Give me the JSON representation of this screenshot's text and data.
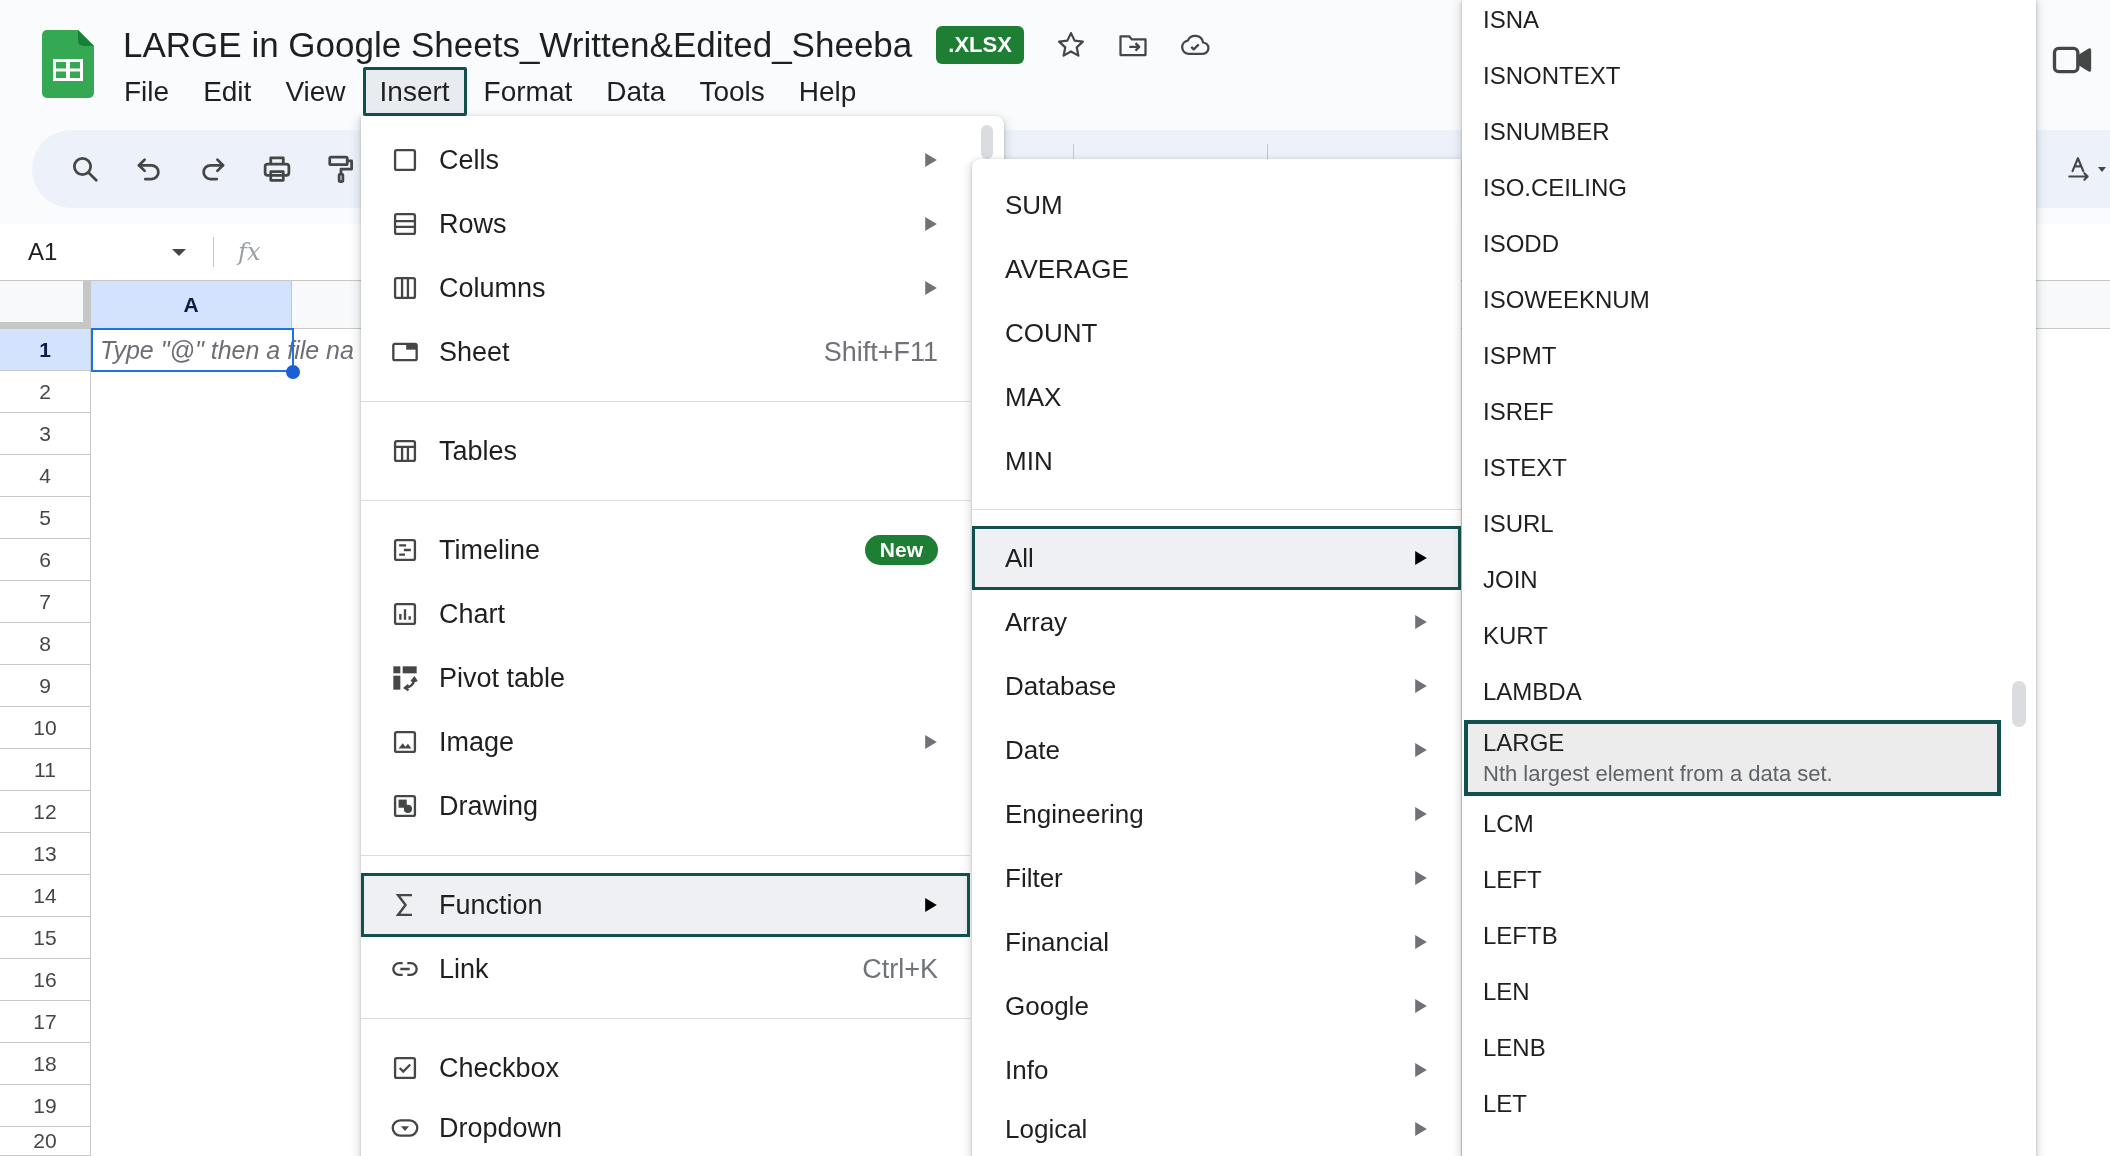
{
  "document": {
    "title": "LARGE in Google Sheets_Written&Edited_Sheeba",
    "file_type_badge": ".XLSX"
  },
  "menu_bar": [
    {
      "label": "File",
      "selected": false
    },
    {
      "label": "Edit",
      "selected": false
    },
    {
      "label": "View",
      "selected": false
    },
    {
      "label": "Insert",
      "selected": true
    },
    {
      "label": "Format",
      "selected": false
    },
    {
      "label": "Data",
      "selected": false
    },
    {
      "label": "Tools",
      "selected": false
    },
    {
      "label": "Help",
      "selected": false
    }
  ],
  "formula_bar": {
    "cell_reference": "A1",
    "function_symbol": "fx"
  },
  "grid": {
    "columns": [
      {
        "label": "A",
        "selected": true
      }
    ],
    "rows": [
      {
        "label": "1",
        "selected": true
      },
      {
        "label": "2",
        "selected": false
      },
      {
        "label": "3",
        "selected": false
      },
      {
        "label": "4",
        "selected": false
      },
      {
        "label": "5",
        "selected": false
      },
      {
        "label": "6",
        "selected": false
      },
      {
        "label": "7",
        "selected": false
      },
      {
        "label": "8",
        "selected": false
      },
      {
        "label": "9",
        "selected": false
      },
      {
        "label": "10",
        "selected": false
      },
      {
        "label": "11",
        "selected": false
      },
      {
        "label": "12",
        "selected": false
      },
      {
        "label": "13",
        "selected": false
      },
      {
        "label": "14",
        "selected": false
      },
      {
        "label": "15",
        "selected": false
      },
      {
        "label": "16",
        "selected": false
      },
      {
        "label": "17",
        "selected": false
      },
      {
        "label": "18",
        "selected": false
      },
      {
        "label": "19",
        "selected": false
      },
      {
        "label": "20",
        "selected": false
      }
    ],
    "active_cell": {
      "placeholder": "Type \"@\" then a file na"
    }
  },
  "insert_menu": {
    "sections": [
      {
        "items": [
          {
            "label": "Cells",
            "has_submenu": true,
            "selected": false
          },
          {
            "label": "Rows",
            "has_submenu": true,
            "selected": false
          },
          {
            "label": "Columns",
            "has_submenu": true,
            "selected": false
          },
          {
            "label": "Sheet",
            "shortcut": "Shift+F11",
            "has_submenu": false,
            "selected": false
          }
        ]
      },
      {
        "items": [
          {
            "label": "Tables",
            "has_submenu": false,
            "selected": false
          }
        ]
      },
      {
        "items": [
          {
            "label": "Timeline",
            "badge": "New",
            "has_submenu": false,
            "selected": false
          },
          {
            "label": "Chart",
            "has_submenu": false,
            "selected": false
          },
          {
            "label": "Pivot table",
            "has_submenu": false,
            "selected": false
          },
          {
            "label": "Image",
            "has_submenu": true,
            "selected": false
          },
          {
            "label": "Drawing",
            "has_submenu": false,
            "selected": false
          }
        ]
      },
      {
        "items": [
          {
            "label": "Function",
            "has_submenu": true,
            "selected": true
          },
          {
            "label": "Link",
            "shortcut": "Ctrl+K",
            "has_submenu": false,
            "selected": false
          }
        ]
      },
      {
        "items": [
          {
            "label": "Checkbox",
            "has_submenu": false,
            "selected": false
          },
          {
            "label": "Dropdown",
            "has_submenu": false,
            "selected": false
          }
        ]
      }
    ]
  },
  "function_menu": {
    "sections": [
      {
        "items": [
          {
            "label": "SUM",
            "has_submenu": false,
            "selected": false
          },
          {
            "label": "AVERAGE",
            "has_submenu": false,
            "selected": false
          },
          {
            "label": "COUNT",
            "has_submenu": false,
            "selected": false
          },
          {
            "label": "MAX",
            "has_submenu": false,
            "selected": false
          },
          {
            "label": "MIN",
            "has_submenu": false,
            "selected": false
          }
        ]
      },
      {
        "items": [
          {
            "label": "All",
            "has_submenu": true,
            "selected": true
          },
          {
            "label": "Array",
            "has_submenu": true,
            "selected": false
          },
          {
            "label": "Database",
            "has_submenu": true,
            "selected": false
          },
          {
            "label": "Date",
            "has_submenu": true,
            "selected": false
          },
          {
            "label": "Engineering",
            "has_submenu": true,
            "selected": false
          },
          {
            "label": "Filter",
            "has_submenu": true,
            "selected": false
          },
          {
            "label": "Financial",
            "has_submenu": true,
            "selected": false
          },
          {
            "label": "Google",
            "has_submenu": true,
            "selected": false
          },
          {
            "label": "Info",
            "has_submenu": true,
            "selected": false
          },
          {
            "label": "Logical",
            "has_submenu": true,
            "selected": false
          }
        ]
      }
    ]
  },
  "function_list": {
    "items": [
      {
        "label": "ISNA",
        "selected": false
      },
      {
        "label": "ISNONTEXT",
        "selected": false
      },
      {
        "label": "ISNUMBER",
        "selected": false
      },
      {
        "label": "ISO.CEILING",
        "selected": false
      },
      {
        "label": "ISODD",
        "selected": false
      },
      {
        "label": "ISOWEEKNUM",
        "selected": false
      },
      {
        "label": "ISPMT",
        "selected": false
      },
      {
        "label": "ISREF",
        "selected": false
      },
      {
        "label": "ISTEXT",
        "selected": false
      },
      {
        "label": "ISURL",
        "selected": false
      },
      {
        "label": "JOIN",
        "selected": false
      },
      {
        "label": "KURT",
        "selected": false
      },
      {
        "label": "LAMBDA",
        "selected": false
      },
      {
        "label": "LARGE",
        "description": "Nth largest element from a data set.",
        "selected": true
      },
      {
        "label": "LCM",
        "selected": false
      },
      {
        "label": "LEFT",
        "selected": false
      },
      {
        "label": "LEFTB",
        "selected": false
      },
      {
        "label": "LEN",
        "selected": false
      },
      {
        "label": "LENB",
        "selected": false
      },
      {
        "label": "LET",
        "selected": false
      }
    ]
  }
}
